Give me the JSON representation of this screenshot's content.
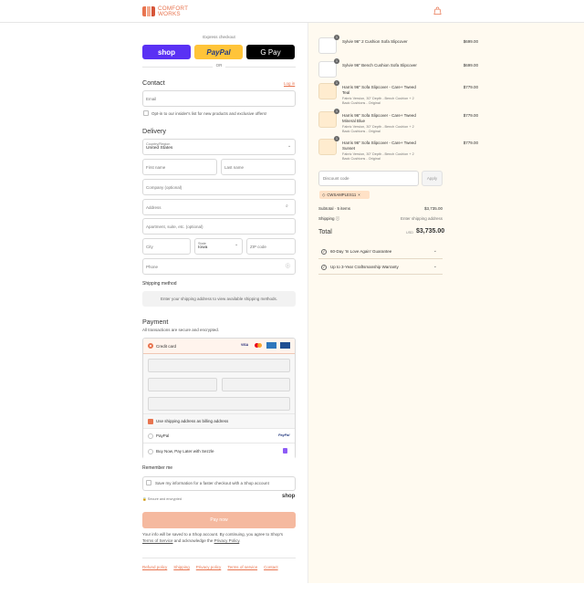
{
  "brand": {
    "name_line1": "COMFORT",
    "name_line2": "WORKS",
    "color": "#e8744f"
  },
  "header": {
    "cart_icon": "shopping-bag-icon"
  },
  "express": {
    "title": "Express checkout",
    "shop_label": "shop",
    "paypal_label": "PayPal",
    "gpay_label": "G Pay",
    "or": "OR"
  },
  "contact": {
    "title": "Contact",
    "login": "Log in",
    "email_placeholder": "Email",
    "optin_label": "Opt-in to our insider's list for new products and exclusive offers!"
  },
  "delivery": {
    "title": "Delivery",
    "country_label": "Country/Region",
    "country_value": "United States",
    "first_name": "First name",
    "last_name": "Last name",
    "company": "Company (optional)",
    "address": "Address",
    "apartment": "Apartment, suite, etc. (optional)",
    "city": "City",
    "state_label": "State",
    "state_value": "Iowa",
    "zip": "ZIP code",
    "phone": "Phone"
  },
  "shipping_method": {
    "title": "Shipping method",
    "message": "Enter your shipping address to view available shipping methods."
  },
  "payment": {
    "title": "Payment",
    "subtitle": "All transactions are secure and encrypted.",
    "credit_card": "Credit card",
    "billing_same": "Use shipping address as billing address",
    "paypal": "PayPal",
    "sezzle": "Buy Now, Pay Later with Sezzle"
  },
  "remember": {
    "title": "Remember me",
    "save_label": "Save my information for a faster checkout with a Shop account",
    "secure": "Secure and encrypted",
    "shop_badge": "shop"
  },
  "pay_now": "Pay now",
  "legal": {
    "line1": "Your info will be saved to a Shop account. By continuing, you agree to Shop's",
    "terms": "Terms of Service",
    "line2": "and acknowledge the",
    "privacy": "Privacy Policy",
    "end": "."
  },
  "footer_links": [
    "Refund policy",
    "Shipping",
    "Privacy policy",
    "Terms of service",
    "Contact"
  ],
  "cart": {
    "items": [
      {
        "qty": "1",
        "name": "Sylvie 96\" 2 Cushion Sofa Slipcover",
        "details": [],
        "price": "$699.00",
        "thumb": "image"
      },
      {
        "qty": "1",
        "name": "Sylvie 96\" Bench Cushion Sofa Slipcover",
        "details": [],
        "price": "$699.00",
        "thumb": "image"
      },
      {
        "qty": "1",
        "name": "Harris 96\" Sofa Slipcover - Care+ Tweed Teal",
        "details": [
          "Fabric Version, 30\" Depth - Bench Cushion + 2",
          "Back Cushions - Original"
        ],
        "price": "$779.00",
        "thumb": "placeholder"
      },
      {
        "qty": "1",
        "name": "Harris 96\" Sofa Slipcover - Care+ Tweed Mineral Blue",
        "details": [
          "Fabric Version, 30\" Depth - Bench Cushion + 2",
          "Back Cushions - Original"
        ],
        "price": "$779.00",
        "thumb": "placeholder"
      },
      {
        "qty": "1",
        "name": "Harris 96\" Sofa Slipcover - Care+ Tweed Sunset",
        "details": [
          "Fabric Version, 30\" Depth - Bench Cushion + 2",
          "Back Cushions - Original"
        ],
        "price": "$779.00",
        "thumb": "placeholder"
      }
    ],
    "discount_placeholder": "Discount code",
    "apply": "Apply",
    "applied_code": "CWSAMPLES11",
    "subtotal_label": "Subtotal · 5 items",
    "subtotal_value": "$3,735.00",
    "shipping_label": "Shipping",
    "shipping_value": "Enter shipping address",
    "total_label": "Total",
    "total_currency": "USD",
    "total_value": "$3,735.00",
    "guarantees": [
      "60-Day 'In Love Again' Guarantee",
      "Up to 3-Year Craftsmanship Warranty"
    ]
  }
}
